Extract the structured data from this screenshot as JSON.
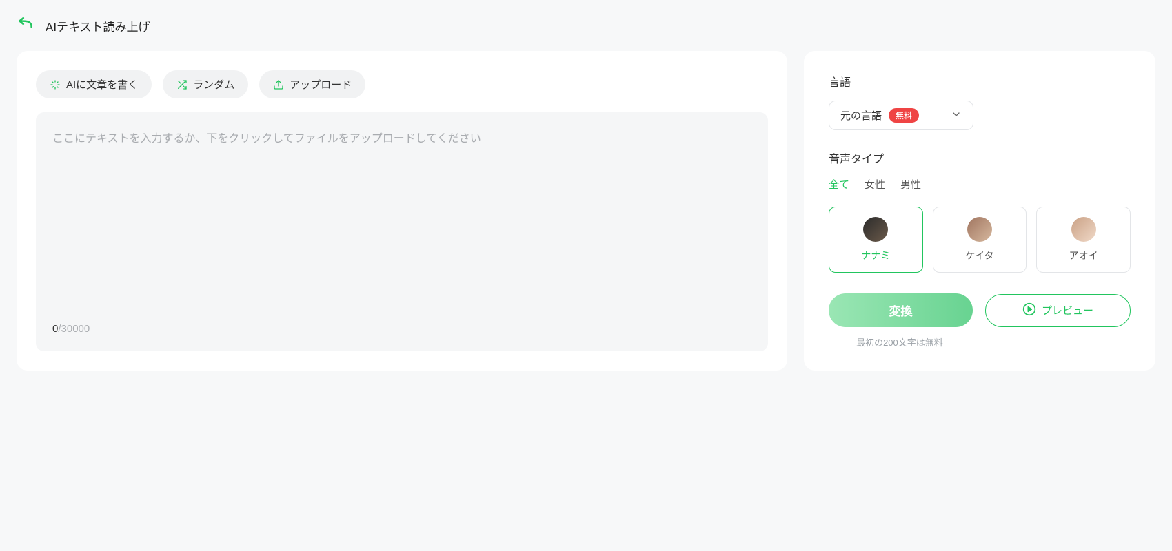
{
  "header": {
    "title": "AIテキスト読み上げ"
  },
  "toolbar": {
    "ai_write_label": "AIに文章を書く",
    "random_label": "ランダム",
    "upload_label": "アップロード"
  },
  "editor": {
    "placeholder": "ここにテキストを入力するか、下をクリックしてファイルをアップロードしてください",
    "char_current": "0",
    "char_sep": "/",
    "char_max": "30000"
  },
  "sidebar": {
    "language_label": "言語",
    "language_select": {
      "value": "元の言語",
      "badge": "無料"
    },
    "voice_type_label": "音声タイプ",
    "tabs": {
      "all": "全て",
      "female": "女性",
      "male": "男性"
    },
    "voices": [
      {
        "name": "ナナミ"
      },
      {
        "name": "ケイタ"
      },
      {
        "name": "アオイ"
      }
    ],
    "convert_label": "変換",
    "preview_label": "プレビュー",
    "hint": "最初の200文字は無料"
  }
}
